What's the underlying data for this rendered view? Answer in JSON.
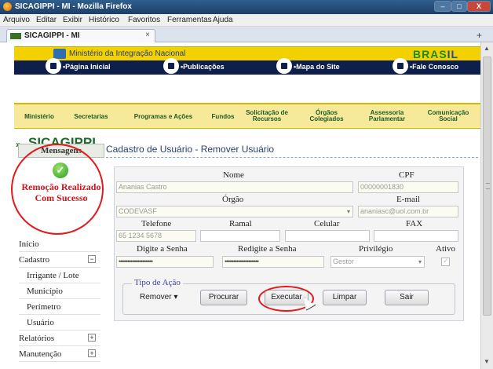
{
  "window": {
    "title": "SICAGIPPI - MI - Mozilla Firefox",
    "minimize": "–",
    "maximize": "□",
    "close": "X"
  },
  "menubar": [
    "Arquivo",
    "Editar",
    "Exibir",
    "Histórico",
    "Favoritos",
    "Ferramentas",
    "Ajuda"
  ],
  "tab": {
    "label": "SICAGIPPI - MI",
    "close": "×",
    "new": "+"
  },
  "gov": {
    "ministry": "Ministério da Integração Nacional",
    "brasil_a": "BRAS",
    "brasil_b": "IL"
  },
  "nav": [
    "•Página Inicial",
    "•Publicações",
    "•Mapa do Site",
    "•Fale Conosco"
  ],
  "mainmenu": [
    "Ministério",
    "Secretarias",
    "Programas e Ações",
    "Fundos",
    "Solicitação de Recursos",
    "Órgãos Colegiados",
    "Assessoria Parlamentar",
    "Comunicação Social"
  ],
  "site": {
    "title": "SICAGIPPI"
  },
  "message": {
    "header": "Mensagens",
    "text": "Remoção Realizado Com Sucesso"
  },
  "sidebar": {
    "items": [
      {
        "label": "Início",
        "toggle": ""
      },
      {
        "label": "Cadastro",
        "toggle": "⊟"
      },
      {
        "label": "Irrigante / Lote",
        "toggle": ""
      },
      {
        "label": "Município",
        "toggle": ""
      },
      {
        "label": "Perímetro",
        "toggle": ""
      },
      {
        "label": "Usuário",
        "toggle": ""
      },
      {
        "label": "Relatórios",
        "toggle": "⊞"
      },
      {
        "label": "Manutenção",
        "toggle": "⊞"
      }
    ]
  },
  "form": {
    "title": "Cadastro de Usuário - Remover Usuário",
    "labels": {
      "nome": "Nome",
      "cpf": "CPF",
      "orgao": "Órgão",
      "email": "E-mail",
      "telefone": "Telefone",
      "ramal": "Ramal",
      "celular": "Celular",
      "fax": "FAX",
      "senha": "Digite a Senha",
      "redigite": "Redigite a Senha",
      "privilegio": "Privilégio",
      "ativo": "Ativo"
    },
    "values": {
      "nome": "Ananias Castro",
      "cpf": "00000001830",
      "orgao": "CODEVASF",
      "email": "ananiasc@uol.com.br",
      "telefone": "65 1234 5678",
      "ramal": "",
      "celular": "",
      "fax": "",
      "senha": "••••••••••••••••••••",
      "redigite": "••••••••••••••••••••",
      "privilegio": "Gestor"
    },
    "action": {
      "legend": "Tipo de Ação",
      "selected": "Remover",
      "buttons": {
        "procurar": "Procurar",
        "executar": "Executar",
        "limpar": "Limpar",
        "sair": "Sair"
      }
    }
  }
}
